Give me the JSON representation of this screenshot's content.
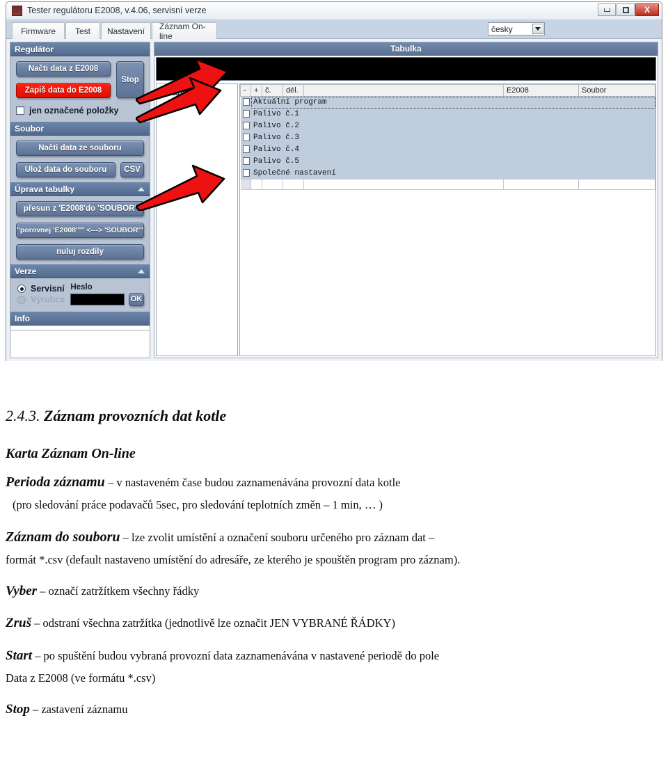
{
  "window": {
    "title": "Tester regulátoru E2008, v.4.06, servisní verze",
    "controls": {
      "minimize": "–",
      "maximize": "❐",
      "close": "X"
    }
  },
  "tabs": [
    {
      "label": "Firmware",
      "active": false
    },
    {
      "label": "Test",
      "active": false
    },
    {
      "label": "Nastavení",
      "active": true
    },
    {
      "label": "Záznam On-line",
      "active": false
    }
  ],
  "language_select": {
    "value": "česky"
  },
  "sidebar": {
    "sections": [
      {
        "header": "Regulátor",
        "buttons": {
          "read": "Načti data z E2008",
          "write": "Zapiš data do E2008",
          "stop": "Stop"
        },
        "checkbox": {
          "label": "jen označené položky",
          "checked": false
        }
      },
      {
        "header": "Soubor",
        "buttons": {
          "load_file": "Načti data ze souboru",
          "save_file": "Ulož data do souboru",
          "csv": "CSV"
        }
      },
      {
        "header": "Úprava tabulky",
        "buttons": {
          "transfer": "přesun z 'E2008'do 'SOUBOR'",
          "compare": "\"porovnej  'E2008'\"\" <---> 'SOUBOR'\"",
          "zero": "nuluj rozdíly"
        }
      },
      {
        "header": "Verze",
        "radios": [
          {
            "label": "Servisní",
            "selected": true,
            "disabled": false
          },
          {
            "label": "Výrobce",
            "selected": false,
            "disabled": true
          }
        ],
        "password": {
          "label": "Heslo",
          "value": "",
          "ok_button": "OK"
        }
      },
      {
        "header": "Info"
      }
    ]
  },
  "table_panel": {
    "title": "Tabulka",
    "tree": {
      "root_label": "Nastavení",
      "expander": "+"
    },
    "grid": {
      "headers": [
        "-",
        "+",
        "č.",
        "dél.",
        "",
        "E2008",
        "Soubor"
      ],
      "rows": [
        {
          "name": "Aktuální program",
          "checked": false,
          "selected": true
        },
        {
          "name": "Palivo č.1",
          "checked": false,
          "selected": false
        },
        {
          "name": "Palivo č.2",
          "checked": false,
          "selected": false
        },
        {
          "name": "Palivo č.3",
          "checked": false,
          "selected": false
        },
        {
          "name": "Palivo č.4",
          "checked": false,
          "selected": false
        },
        {
          "name": "Palivo č.5",
          "checked": false,
          "selected": false
        },
        {
          "name": "Společné nastavení",
          "checked": false,
          "selected": false
        }
      ]
    }
  },
  "annotations": {
    "arrow_color": "#ee1111",
    "arrow_outline": "#000000",
    "count": 3
  },
  "document": {
    "section_number": "2.4.3.",
    "section_title": "Záznam provozních dat kotle",
    "subtitle": "Karta Záznam On-line",
    "paragraphs": [
      {
        "lead": "Perioda záznamu",
        "text": " – v nastaveném čase budou zaznamenávána provozní data kotle",
        "continuation": "(pro sledování práce podavačů 5sec, pro sledování teplotních změn – 1 min, … )"
      },
      {
        "lead": "Záznam do souboru",
        "text": " – lze zvolit umístění a označení souboru určeného pro záznam dat –",
        "continuation": "formát *.csv (default nastaveno umístění do adresáře, ze kterého je spouštěn program pro záznam)."
      },
      {
        "lead": "Vyber",
        "text": " – označí zatržítkem všechny řádky",
        "continuation": ""
      },
      {
        "lead": "Zruš",
        "text": " – odstraní všechna zatržítka (jednotlivě lze označit JEN VYBRANÉ ŘÁDKY)",
        "continuation": ""
      },
      {
        "lead": "Start",
        "text": " – po spuštění budou vybraná provozní data zaznamenávána v nastavené periodě do pole",
        "continuation": "Data z E2008 (ve formátu *.csv)"
      },
      {
        "lead": "Stop",
        "text": " – zastavení záznamu",
        "continuation": ""
      }
    ]
  }
}
